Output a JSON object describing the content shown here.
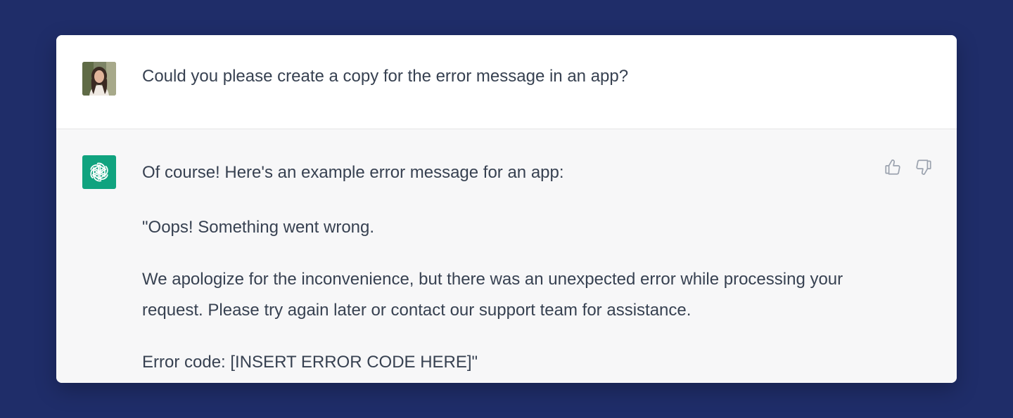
{
  "conversation": {
    "user_message": "Could you please create a copy for the error message in an app?",
    "assistant_paragraphs": [
      "Of course! Here's an example error message for an app:",
      "\"Oops! Something went wrong.",
      "We apologize for the inconvenience, but there was an unexpected error while processing your request. Please try again later or contact our support team for assistance.",
      "Error code: [INSERT ERROR CODE HERE]\""
    ]
  },
  "icons": {
    "user_avatar": "user-avatar-photo",
    "assistant_avatar": "openai-logo-icon",
    "like": "thumbs-up-icon",
    "dislike": "thumbs-down-icon"
  },
  "colors": {
    "background": "#1f2d69",
    "assistant_accent": "#10a37f",
    "text": "#374151"
  }
}
